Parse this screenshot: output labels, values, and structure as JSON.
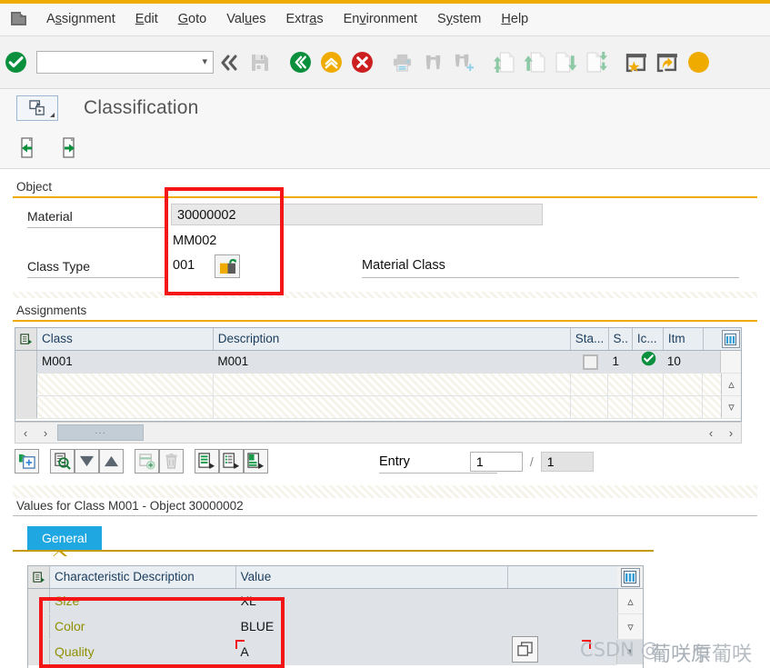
{
  "window": {
    "title": "Classification",
    "system_icon": "window-menu-icon"
  },
  "menubar": {
    "items": [
      {
        "label": "Assignment",
        "accel": "s"
      },
      {
        "label": "Edit",
        "accel": "E"
      },
      {
        "label": "Goto",
        "accel": "G"
      },
      {
        "label": "Values",
        "accel": "u"
      },
      {
        "label": "Extras",
        "accel": "a"
      },
      {
        "label": "Environment",
        "accel": "v"
      },
      {
        "label": "System",
        "accel": "y"
      },
      {
        "label": "Help",
        "accel": "H"
      }
    ]
  },
  "toolbar": {
    "command_field_value": "",
    "command_field_placeholder": "",
    "icons": [
      {
        "name": "enter-check-icon",
        "tooltip": "Continue (Enter)"
      },
      {
        "name": "collapse-left-icon",
        "tooltip": "Collapse"
      },
      {
        "name": "save-icon",
        "tooltip": "Save"
      },
      {
        "name": "back-icon",
        "tooltip": "Back (F3)"
      },
      {
        "name": "exit-icon",
        "tooltip": "Exit"
      },
      {
        "name": "cancel-icon",
        "tooltip": "Cancel (F12)"
      },
      {
        "name": "print-icon",
        "tooltip": "Print"
      },
      {
        "name": "find-icon",
        "tooltip": "Find"
      },
      {
        "name": "find-next-icon",
        "tooltip": "Find Next"
      },
      {
        "name": "first-page-icon",
        "tooltip": "First Page"
      },
      {
        "name": "previous-page-icon",
        "tooltip": "Previous Page"
      },
      {
        "name": "next-page-icon",
        "tooltip": "Next Page"
      },
      {
        "name": "last-page-icon",
        "tooltip": "Last Page"
      },
      {
        "name": "create-favorite-icon",
        "tooltip": "Create Session"
      },
      {
        "name": "create-shortcut-icon",
        "tooltip": "Create Shortcut"
      },
      {
        "name": "help-icon",
        "tooltip": "Help"
      }
    ]
  },
  "app_toolbar": {
    "buttons": [
      {
        "name": "previous-object-icon",
        "tooltip": "Previous Object"
      },
      {
        "name": "next-object-icon",
        "tooltip": "Next Object"
      }
    ]
  },
  "object_group": {
    "legend": "Object",
    "material_label": "Material",
    "material_value": "30000002",
    "material_subvalue": "MM002",
    "class_type_label": "Class Type",
    "class_type_value": "001",
    "class_type_description": "Material Class",
    "lock_icon": "lock-unlock-icon"
  },
  "assignments_group": {
    "legend": "Assignments",
    "columns": [
      {
        "key": "class",
        "label": "Class"
      },
      {
        "key": "description",
        "label": "Description"
      },
      {
        "key": "status",
        "label": "Sta..."
      },
      {
        "key": "s",
        "label": "S.."
      },
      {
        "key": "ic",
        "label": "Ic..."
      },
      {
        "key": "itm",
        "label": "Itm"
      }
    ],
    "rows": [
      {
        "class": "M001",
        "description": "M001",
        "status": "",
        "s": "1",
        "ic": "green-check-icon",
        "itm": "10"
      }
    ],
    "empty_rows": 2,
    "config_icon": "table-settings-icon",
    "hscroll_thumb_glyph": "···",
    "toolbar_buttons": [
      {
        "name": "assign-new-class-icon",
        "tooltip": "Assign New Class"
      },
      {
        "name": "find-in-class-icon",
        "tooltip": "Find"
      },
      {
        "name": "sort-descending-icon",
        "tooltip": "Sort Descending"
      },
      {
        "name": "sort-ascending-icon",
        "tooltip": "Sort Ascending"
      },
      {
        "name": "insert-row-icon",
        "tooltip": "Insert Row"
      },
      {
        "name": "delete-row-icon",
        "tooltip": "Delete Row"
      },
      {
        "name": "list-detail1-icon",
        "tooltip": "Details"
      },
      {
        "name": "list-detail2-icon",
        "tooltip": "Class Data"
      },
      {
        "name": "list-detail3-icon",
        "tooltip": "Characteristics"
      }
    ],
    "entry_label": "Entry",
    "entry_current": "1",
    "entry_separator": "/",
    "entry_total": "1"
  },
  "values_group": {
    "legend": "Values for Class M001 - Object 30000002",
    "tabs": [
      {
        "label": "General",
        "active": true
      }
    ],
    "columns": [
      {
        "key": "characteristic",
        "label": "Characteristic Description"
      },
      {
        "key": "value",
        "label": "Value"
      }
    ],
    "rows": [
      {
        "characteristic": "Size",
        "value": "XL"
      },
      {
        "characteristic": "Color",
        "value": "BLUE"
      },
      {
        "characteristic": "Quality",
        "value": "A"
      }
    ],
    "config_icon": "table-settings-icon",
    "expand_icon": "expand-value-icon"
  },
  "annotations": {
    "boxes": [
      {
        "name": "object-fields-highlight"
      },
      {
        "name": "characteristic-values-highlight"
      }
    ],
    "color": "#f41616"
  },
  "watermark": {
    "prefix": "CSDN @",
    "text1": "葡咲原",
    "text2": "乍葡咲"
  }
}
